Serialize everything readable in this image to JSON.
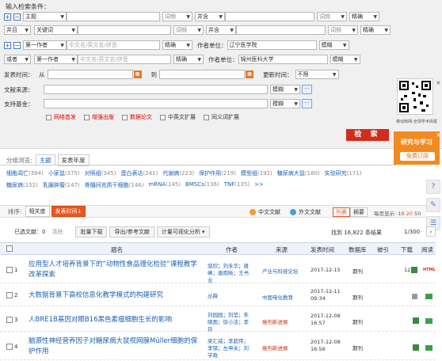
{
  "panel_title": "输入检索条件：",
  "rows": [
    {
      "field1": "主题",
      "freq1": "词频",
      "logic": "并含",
      "freq2": "词频",
      "match": "精确"
    },
    {
      "op": "并且",
      "field1": "关键词",
      "freq1": "词频",
      "logic": "并含",
      "freq2": "词频",
      "match": "精确"
    }
  ],
  "author_rows": [
    {
      "field": "第一作者",
      "placeholder": "中文名/英文名/拼音",
      "match": "精确",
      "unit_label": "作者单位：",
      "unit_value": "辽宁医学院",
      "unit_match": "模糊"
    },
    {
      "op": "或者",
      "field": "第一作者",
      "placeholder": "中文名/英文名/拼音",
      "match": "精确",
      "unit_label": "作者单位：",
      "unit_value": "锦州医科大学",
      "unit_match": "模糊"
    }
  ],
  "time": {
    "label": "发表时间：",
    "from": "从",
    "to": "到",
    "update_label": "更新时间：",
    "update_value": "不限"
  },
  "source": {
    "label": "文献来源：",
    "match": "模糊"
  },
  "fund": {
    "label": "支持基金：",
    "match": "模糊"
  },
  "checkboxes": [
    {
      "label": "网络首发",
      "red": true
    },
    {
      "label": "增强出版",
      "red": true
    },
    {
      "label": "数据论文",
      "red": true
    },
    {
      "label": "中英文扩展",
      "red": false
    },
    {
      "label": "同义词扩展",
      "red": false
    }
  ],
  "search_button": "检 索",
  "qr_caption": "移动知网-全球学术快报",
  "promo": {
    "line1": "研究与学习",
    "button": "免费订阅"
  },
  "group": {
    "label": "分组浏览:",
    "tabs": [
      "主题",
      "发表年度"
    ]
  },
  "topics_row1": [
    {
      "name": "细胞凋亡",
      "count": "(394)"
    },
    {
      "name": "小家鼠",
      "count": "(375)"
    },
    {
      "name": "对照组",
      "count": "(345)"
    },
    {
      "name": "蛋白表达",
      "count": "(241)"
    },
    {
      "name": "代谢病",
      "count": "(223)"
    },
    {
      "name": "保护作用",
      "count": "(219)"
    },
    {
      "name": "模型组",
      "count": "(192)"
    },
    {
      "name": "糖尿病大鼠",
      "count": "(180)"
    },
    {
      "name": "实验研究",
      "count": "(171)"
    }
  ],
  "topics_row2": [
    {
      "name": "糖尿病",
      "count": "(152)"
    },
    {
      "name": "乳腺肿瘤",
      "count": "(147)"
    },
    {
      "name": "骨髓间充质干细胞",
      "count": "(146)"
    },
    {
      "name": "mRNA",
      "count": "(145)"
    },
    {
      "name": "BMSCs",
      "count": "(136)"
    },
    {
      "name": "TNF",
      "count": "(135)"
    },
    {
      "name": ">>",
      "count": ""
    }
  ],
  "sort": {
    "label": "排序:",
    "options": [
      "相关度",
      "发表时间↓"
    ]
  },
  "lang": {
    "cn": "中文文献",
    "en": "外文文献"
  },
  "view": {
    "list": "列表",
    "summary": "摘要"
  },
  "perpage": {
    "label": "每页显示:",
    "opts": [
      "10",
      "20",
      "50"
    ]
  },
  "toolbar": {
    "selected": "已选文献：",
    "selected_count": "0",
    "clear": "清除",
    "buttons": [
      "批量下载",
      "导出/参考文献",
      "计量可视化分析 ▾"
    ]
  },
  "found": "找到 16,822 条结果",
  "pager": "1/300",
  "headers": {
    "title": "题名",
    "author": "作者",
    "source": "来源",
    "date": "发表时间",
    "db": "数据库",
    "cite": "被引",
    "dl": "下载",
    "read": "阅读"
  },
  "results": [
    {
      "num": "1",
      "title": "应用型人才培养背景下的“动物性食品理化检验”课程教学改革探索",
      "author": "寇欣；刘永华；唐峰；唐雨晰；王书业",
      "source": "产业与科技论坛",
      "source_red": false,
      "date": "2017-12-15",
      "db": "期刊",
      "cite": "",
      "dl": "12"
    },
    {
      "num": "2",
      "title": "大数据背景下高校信息化教学模式的构建研究",
      "author": "丛薇",
      "source": "中国电化教育",
      "source_red": false,
      "date": "2017-12-11 09:34",
      "db": "期刊",
      "cite": "",
      "dl": ""
    },
    {
      "num": "3",
      "title": "人BRE1B基因对眼B16黑色素瘤细胞生长的影响",
      "author": "刘园园；刘莹；朱晓雨；徐小洁；李铃",
      "source": "癌剂新进展",
      "source_red": true,
      "date": "2017-12-08 16:57",
      "db": "期刊",
      "cite": "",
      "dl": ""
    },
    {
      "num": "4",
      "title": "脑源性神经营养因子对糖尿病大鼠视网膜Müller细胞的保护作用",
      "author": "梁汇威；李超伟；李铎；左申关；刘学政",
      "source": "癌剂新进展",
      "source_red": true,
      "date": "2017-12-08 16:56",
      "db": "期刊",
      "cite": "",
      "dl": ""
    }
  ]
}
